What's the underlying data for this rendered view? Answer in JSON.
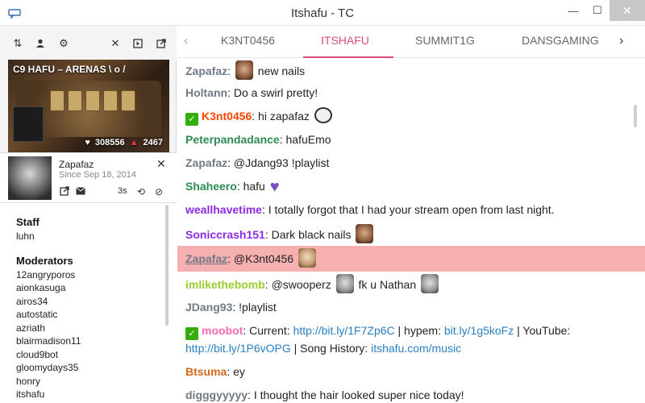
{
  "window": {
    "title": "Itshafu - TC",
    "minimize_glyph": "—",
    "maximize_glyph": "☐",
    "close_glyph": "✕",
    "app_icon": "chat-bubble-icon"
  },
  "colors": {
    "accent": "#e04a7e",
    "mention_highlight": "#f7b0b0",
    "link": "#2a7fc1",
    "subscriber_badge": "#34ae0a"
  },
  "left_toolbar": {
    "icons": [
      "sort-icon",
      "user-icon",
      "gear-icon",
      "close-icon",
      "popout-player-icon",
      "external-link-icon"
    ]
  },
  "stream": {
    "title": "C9 HAFU – ARENAS \\ o /",
    "viewers": "308556",
    "followers": "2467"
  },
  "user_card": {
    "name": "Zapafaz",
    "since": "Since Sep 18, 2014",
    "timeout_label": "3s"
  },
  "userlist": {
    "staff_heading": "Staff",
    "staff": [
      "luhn"
    ],
    "mod_heading": "Moderators",
    "moderators": [
      "12angryporos",
      "aionkasuga",
      "airos34",
      "autostatic",
      "azriath",
      "blairmadison11",
      "cloud9bot",
      "gloomydays35",
      "honry",
      "itshafu"
    ]
  },
  "tabs": {
    "items": [
      "K3NT0456",
      "ITSHAFU",
      "SUMMIT1G",
      "DANSGAMING"
    ],
    "active": "ITSHAFU"
  },
  "chat": {
    "messages": [
      {
        "user": "Zapafaz",
        "color": "#6f7a86",
        "text": "new nails",
        "emotes": [
          "face-dark"
        ]
      },
      {
        "user": "Holtann",
        "color": "#6f7a86",
        "text": "Do a swirl pretty!"
      },
      {
        "user": "K3nt0456",
        "color": "#ff4500",
        "text": "hi zapafaz",
        "badge": true,
        "emotes": [
          "mask"
        ]
      },
      {
        "user": "Peterpandadance",
        "color": "#2e8b57",
        "text": "hafuEmo"
      },
      {
        "user": "Zapafaz",
        "color": "#6f7a86",
        "text": "@Jdang93 !playlist"
      },
      {
        "user": "Shaheero",
        "color": "#2e8b57",
        "text": "hafu",
        "emotes": [
          "heart"
        ]
      },
      {
        "user": "weallhavetime",
        "color": "#8a2be2",
        "text": "I totally forgot that I had your stream open from last night."
      },
      {
        "user": "Soniccrash151",
        "color": "#8a2be2",
        "text": "Dark black nails",
        "emotes": [
          "face-dark"
        ]
      },
      {
        "user": "Zapafaz",
        "color": "#6f7a86",
        "text": "@K3nt0456",
        "highlight": true,
        "emotes": [
          "face-light"
        ]
      },
      {
        "user": "imlikethebomb",
        "color": "#9acd32",
        "text_a": "@swooperz",
        "text_b": "fk u Nathan",
        "emotes": [
          "face-gray",
          "face-gray"
        ]
      },
      {
        "user": "JDang93",
        "color": "#6f7a86",
        "text": "!playlist"
      },
      {
        "user": "moobot",
        "color": "#ff69b4",
        "badge": true,
        "parts": [
          "Current:",
          "http://bit.ly/1F7Zp6C",
          "| hypem:",
          "bit.ly/1g5koFz",
          "| YouTube:",
          "http://bit.ly/1P6vOPG",
          "| Song History:",
          "itshafu.com/music"
        ]
      },
      {
        "user": "Btsuma",
        "color": "#d2691e",
        "text": "ey"
      },
      {
        "user": "digggyyyyy",
        "color": "#6f7a86",
        "text": "I thought the hair looked super nice today!"
      }
    ]
  }
}
